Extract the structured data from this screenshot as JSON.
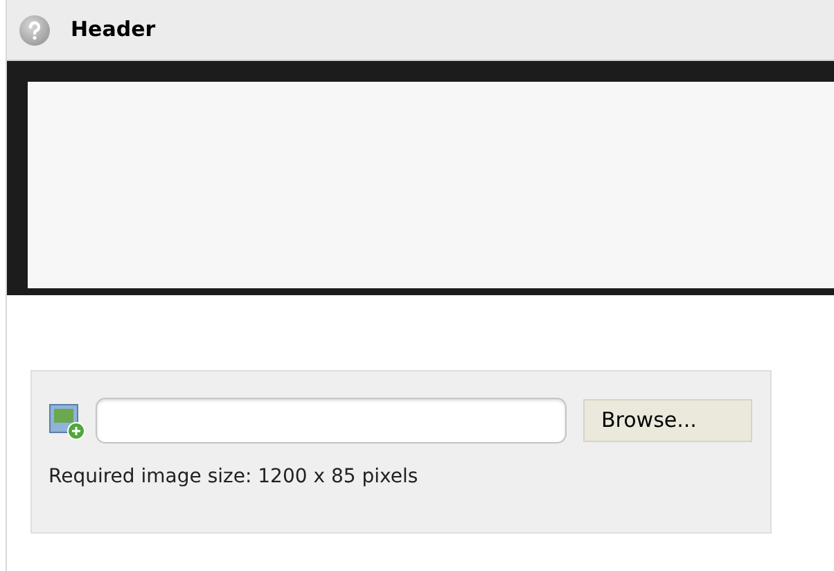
{
  "section": {
    "title": "Header"
  },
  "upload": {
    "button": "Browse...",
    "hint": "Required image size: 1200 x 85 pixels"
  }
}
